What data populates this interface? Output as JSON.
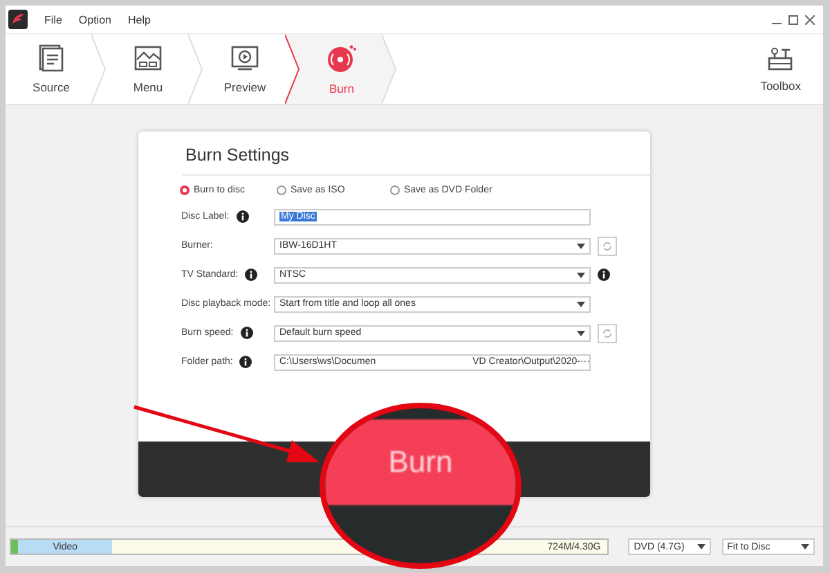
{
  "menu": [
    "File",
    "Option",
    "Help"
  ],
  "steps": [
    {
      "label": "Source",
      "kind": "source",
      "selected": false
    },
    {
      "label": "Menu",
      "kind": "menu",
      "selected": false
    },
    {
      "label": "Preview",
      "kind": "preview",
      "selected": false
    },
    {
      "label": "Burn",
      "kind": "burn",
      "selected": true
    }
  ],
  "toolbox": {
    "label": "Toolbox"
  },
  "dialog": {
    "title": "Burn Settings",
    "outputs": [
      {
        "label": "Burn to disc",
        "selected": true
      },
      {
        "label": "Save as ISO",
        "selected": false
      },
      {
        "label": "Save as DVD Folder",
        "selected": false
      }
    ],
    "fields": [
      {
        "label": "Disc Label:",
        "kind": "text",
        "value": "My Disc",
        "text_selected": true,
        "info": true,
        "refresh": false,
        "trailing_info": false
      },
      {
        "label": "Burner:",
        "kind": "select",
        "value": "IBW-16D1HT",
        "info": false,
        "refresh": true,
        "trailing_info": false
      },
      {
        "label": "TV Standard:",
        "kind": "select",
        "value": "NTSC",
        "info": true,
        "refresh": false,
        "trailing_info": true
      },
      {
        "label": "Disc playback mode:",
        "kind": "select",
        "value": "Start from title and loop all ones",
        "info": false,
        "refresh": false,
        "trailing_info": false
      },
      {
        "label": "Burn speed:",
        "kind": "select",
        "value": "Default burn speed",
        "info": true,
        "refresh": true,
        "trailing_info": false
      },
      {
        "label": "Folder path:",
        "kind": "path",
        "value_start": "C:\\Users\\ws\\Documen",
        "value_end": "VD Creator\\Output\\2020-",
        "browse": "···",
        "info": true,
        "refresh": false,
        "trailing_info": false
      }
    ]
  },
  "magnifier": {
    "button": "Burn"
  },
  "status_bar": {
    "segment": "Video",
    "level": 0.17,
    "usage": "724M/4.30G",
    "disc": "DVD (4.7G)",
    "fit": "Fit to Disc"
  }
}
